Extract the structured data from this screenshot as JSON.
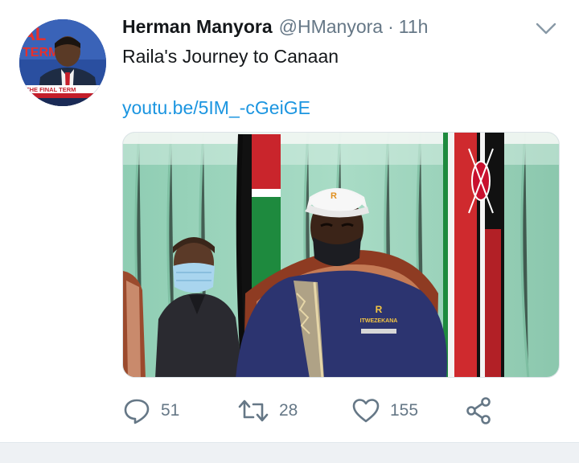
{
  "tweet": {
    "author_name": "Herman Manyora",
    "author_handle": "@HManyora",
    "separator": "·",
    "time": "11h",
    "text": "Raila's Journey to Canaan",
    "link": "youtu.be/5IM_-cGeiGE",
    "avatar_banner_text": "THE FINAL TERM",
    "media_hat_text": "ITWEZEKANA"
  },
  "actions": {
    "reply_count": "51",
    "retweet_count": "28",
    "like_count": "155"
  },
  "icons": {
    "reply": "reply-icon",
    "retweet": "retweet-icon",
    "like": "heart-icon",
    "share": "share-icon",
    "more": "chevron-down-icon"
  },
  "colors": {
    "text": "#14171a",
    "secondary": "#657786",
    "link": "#1b95e0"
  }
}
